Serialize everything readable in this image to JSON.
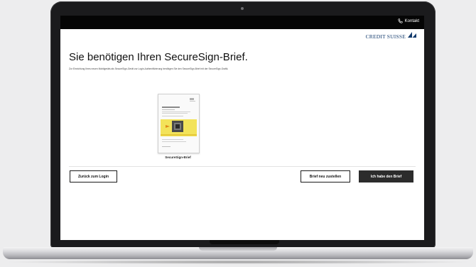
{
  "header": {
    "contact_label": "Kontakt",
    "contact_icon": "phone-icon"
  },
  "brand": {
    "logo_text": "CREDIT SUISSE",
    "logo_icon": "sails-icon",
    "color": "#143c6e"
  },
  "main": {
    "title": "Sie benötigen Ihren SecureSign-Brief.",
    "description": "Zur Einrichtung Ihres neuen Mobilgeräts als SecureSign-Gerät zur Login-Authentifizierung benötigen Sie den SecureSign-Brief mit der SecureSign-Grafik.",
    "letter_caption": "SecureSign-Brief"
  },
  "actions": {
    "back_label": "Zurück zum Login",
    "resend_label": "Brief neu zustellen",
    "have_letter_label": "Ich habe den Brief"
  },
  "colors": {
    "topbar": "#050505",
    "primary_button": "#2c2c2c",
    "letter_highlight": "#f3e35a"
  }
}
